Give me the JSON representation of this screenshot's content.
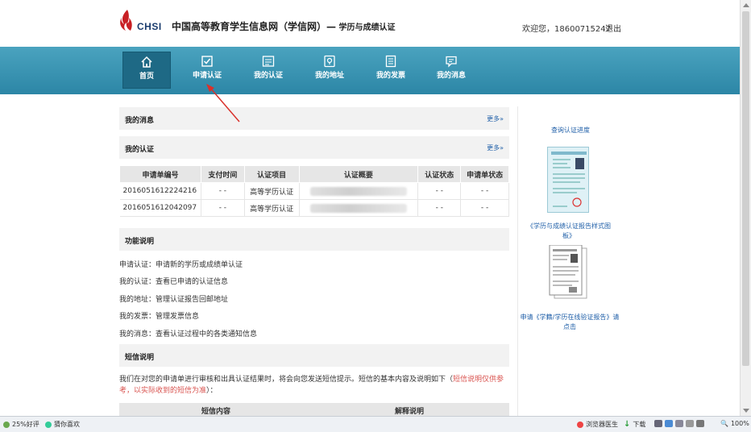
{
  "header": {
    "logo_text": "CHSI",
    "site_title": "中国高等教育学生信息网（学信网）—",
    "site_subtitle": " 学历与成绩认证",
    "welcome": "欢迎您，18600715247",
    "logout": "退出"
  },
  "nav": {
    "items": [
      {
        "label": "首页",
        "icon": "home-icon"
      },
      {
        "label": "申请认证",
        "icon": "checkbox-icon"
      },
      {
        "label": "我的认证",
        "icon": "certificate-icon"
      },
      {
        "label": "我的地址",
        "icon": "location-icon"
      },
      {
        "label": "我的发票",
        "icon": "invoice-icon"
      },
      {
        "label": "我的消息",
        "icon": "message-icon"
      }
    ]
  },
  "messages": {
    "title": "我的消息",
    "more": "更多»"
  },
  "certs": {
    "title": "我的认证",
    "more": "更多»",
    "columns": [
      "申请单编号",
      "支付时间",
      "认证项目",
      "认证概要",
      "认证状态",
      "申请单状态"
    ],
    "rows": [
      {
        "id": "2016051612224216",
        "paid": "- -",
        "item": "高等学历认证",
        "status": "- -",
        "order_status": "- -"
      },
      {
        "id": "2016051612042097",
        "paid": "- -",
        "item": "高等学历认证",
        "status": "- -",
        "order_status": "- -"
      }
    ]
  },
  "functions": {
    "title": "功能说明",
    "lines": [
      "申请认证：申请新的学历或成绩单认证",
      "我的认证：查看已申请的认证信息",
      "我的地址：管理认证报告回邮地址",
      "我的发票：管理发票信息",
      "我的消息：查看认证过程中的各类通知信息"
    ]
  },
  "sms": {
    "title": "短信说明",
    "text": "我们在对您的申请单进行审核和出具认证结果时，将会向您发送短信提示。短信的基本内容及说明如下（",
    "note": "短信说明仅供参考，以实际收到的短信为准",
    "text_end": "）：",
    "col1": "短信内容",
    "col2": "解释说明"
  },
  "side": {
    "progress_link": "查询认证进度",
    "sample_link": "《学历与成绩认证报告样式图板》",
    "apply_link": "申请《学籍/学历在线验证报告》请点击"
  },
  "statusbar": {
    "left1": "25%好评",
    "left2": "猜你喜欢",
    "doctor": "浏览器医生",
    "download": "下载",
    "zoom": "100%"
  },
  "colors": {
    "nav_top": "#4aa3bf",
    "nav_bottom": "#2c86a6",
    "nav_active": "#1e6985",
    "link": "#1f5fa8",
    "note_red": "#d9534f",
    "arrow": "#d9312b"
  }
}
